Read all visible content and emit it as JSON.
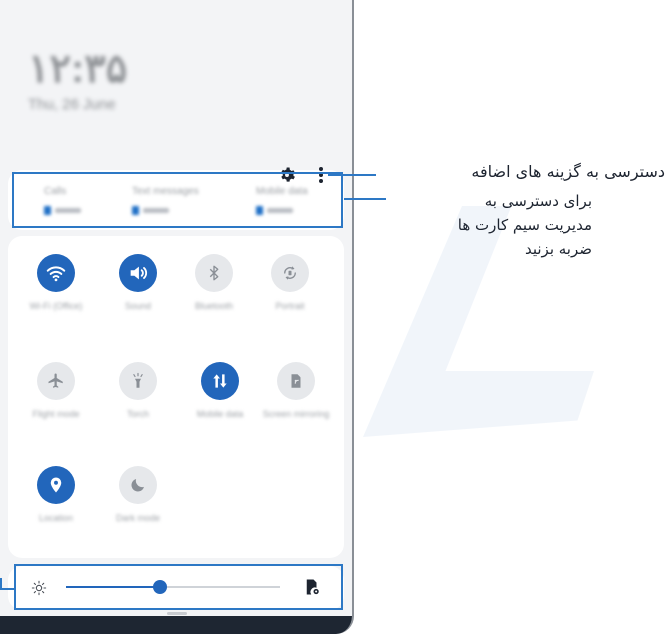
{
  "status": {
    "clock": "۱۲:۳۵",
    "date": "Thu, 26 June"
  },
  "sim_manager": {
    "slots": [
      {
        "name": "Calls",
        "value": "SIM 1"
      },
      {
        "name": "Text messages",
        "value": "SIM 1"
      },
      {
        "name": "Mobile data",
        "value": "SIM 1"
      }
    ]
  },
  "quick_panel": {
    "tiles": [
      {
        "label": "Wi-Fi (Office)",
        "icon": "wifi-icon",
        "state": "on"
      },
      {
        "label": "Sound",
        "icon": "sound-icon",
        "state": "on"
      },
      {
        "label": "Bluetooth",
        "icon": "bluetooth-icon",
        "state": "off"
      },
      {
        "label": "Portrait",
        "icon": "auto-rotate-icon",
        "state": "off"
      },
      {
        "label": "Flight mode",
        "icon": "airplane-icon",
        "state": "off"
      },
      {
        "label": "Torch",
        "icon": "flashlight-icon",
        "state": "off"
      },
      {
        "label": "Mobile data",
        "icon": "mobile-data-icon",
        "state": "on"
      },
      {
        "label": "Screen mirroring",
        "icon": "screen-mirror-icon",
        "state": "off"
      },
      {
        "label": "Location",
        "icon": "location-icon",
        "state": "on"
      },
      {
        "label": "Dark mode",
        "icon": "moon-icon",
        "state": "off"
      }
    ]
  },
  "brightness": {
    "level": 0.44
  },
  "colors": {
    "accent": "#2266bb",
    "callout_line": "#2d78c5"
  },
  "callouts": {
    "more_options": "دسترسی به گزینه های اضافه",
    "sim_line1": "برای دسترسی به",
    "sim_line2": "مدیریت سیم کارت ها",
    "sim_line3": "ضربه بزنید"
  }
}
